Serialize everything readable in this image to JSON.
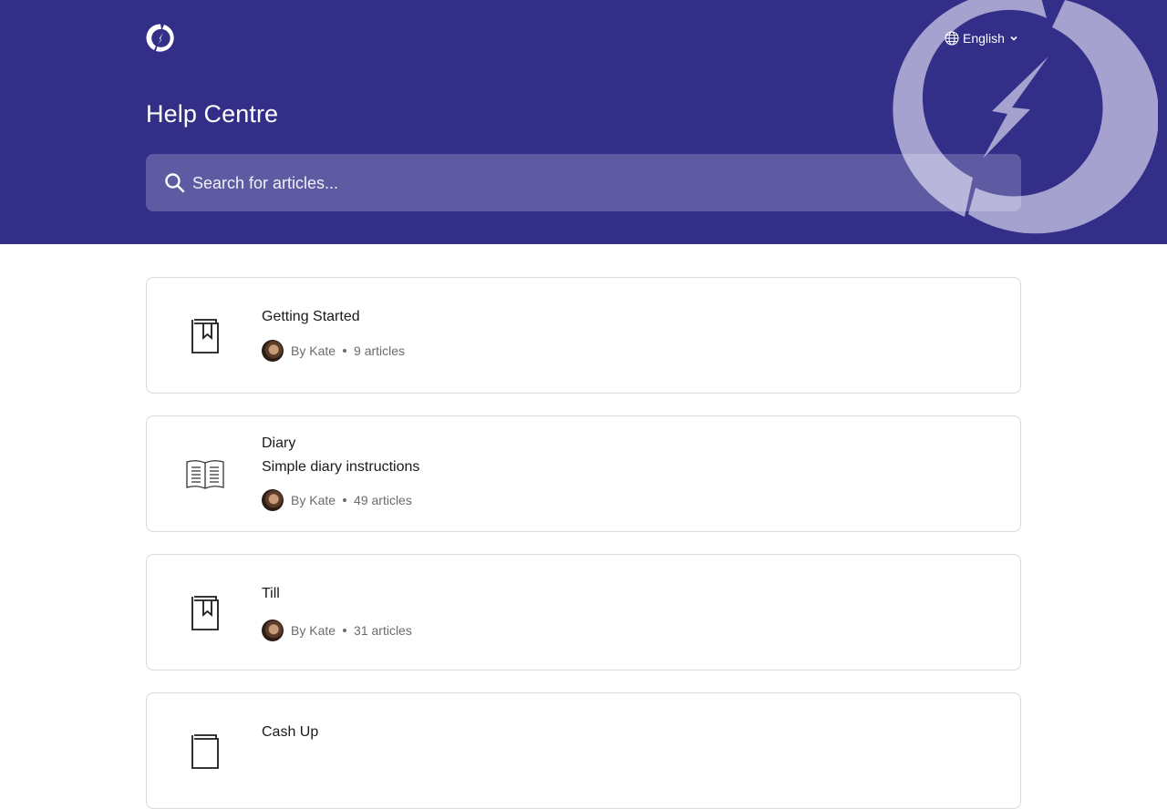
{
  "header": {
    "title": "Help Centre",
    "language": "English",
    "search_placeholder": "Search for articles..."
  },
  "colors": {
    "brand": "#332e88",
    "card_border": "#dcdcdf",
    "meta_text": "#6b6b6b"
  },
  "collections": [
    {
      "icon": "bookmark-book-icon",
      "name": "Getting Started",
      "description": "",
      "author": "By Kate",
      "count": "9 articles"
    },
    {
      "icon": "open-book-icon",
      "name": "Diary",
      "description": "Simple diary instructions",
      "author": "By Kate",
      "count": "49 articles"
    },
    {
      "icon": "bookmark-book-icon",
      "name": "Till",
      "description": "",
      "author": "By Kate",
      "count": "31 articles"
    },
    {
      "icon": "book-icon",
      "name": "Cash Up",
      "description": "",
      "author": "",
      "count": ""
    }
  ]
}
